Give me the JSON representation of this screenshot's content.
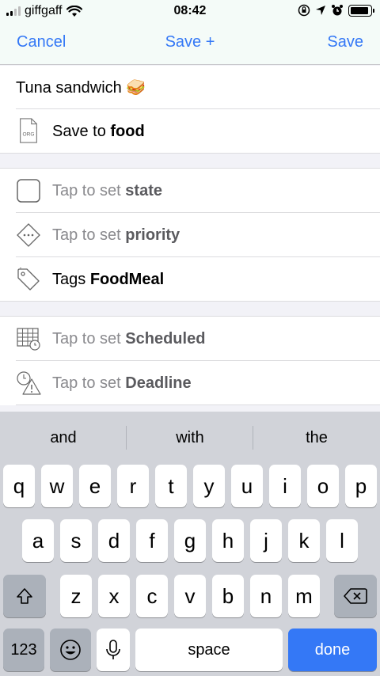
{
  "status_bar": {
    "carrier": "giffgaff",
    "time": "08:42",
    "battery_level": 0.9
  },
  "nav": {
    "cancel_label": "Cancel",
    "save_plus_label": "Save +",
    "save_label": "Save"
  },
  "entry": {
    "title": "Tuna sandwich 🥪",
    "save_prefix": "Save to ",
    "save_target": "food",
    "file_icon_text": "ORG"
  },
  "properties": {
    "state_prefix": "Tap to set ",
    "state_label": "state",
    "priority_prefix": "Tap to set ",
    "priority_label": "priority",
    "tags_prefix": "Tags ",
    "tags_value": "FoodMeal",
    "scheduled_prefix": "Tap to set ",
    "scheduled_label": "Scheduled",
    "deadline_prefix": "Tap to set ",
    "deadline_label": "Deadline"
  },
  "keyboard": {
    "suggestions": [
      "and",
      "with",
      "the"
    ],
    "row1": [
      "q",
      "w",
      "e",
      "r",
      "t",
      "y",
      "u",
      "i",
      "o",
      "p"
    ],
    "row2": [
      "a",
      "s",
      "d",
      "f",
      "g",
      "h",
      "j",
      "k",
      "l"
    ],
    "row3": [
      "z",
      "x",
      "c",
      "v",
      "b",
      "n",
      "m"
    ],
    "numbers_label": "123",
    "space_label": "space",
    "done_label": "done"
  },
  "colors": {
    "accent": "#3478f6",
    "nav_background": "#f4fbf8",
    "keyboard_background": "#d1d3d9"
  }
}
